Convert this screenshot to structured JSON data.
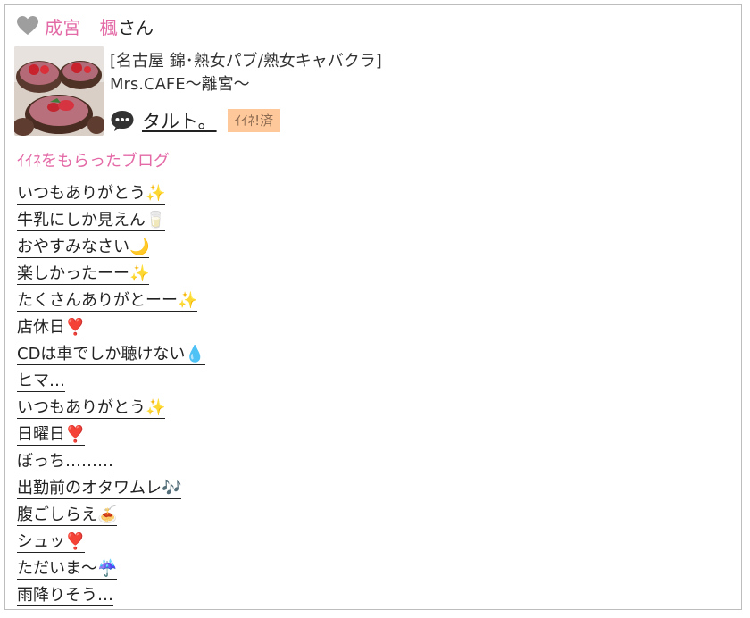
{
  "header": {
    "name": "成宮　楓",
    "honorific": "さん"
  },
  "shop": {
    "category": "[名古屋 錦･熟女パブ/熟女キャバクラ]",
    "name": "Mrs.CAFE〜離宮〜"
  },
  "liker": {
    "name": "タルト。",
    "badge": "ｲｲﾈ!済"
  },
  "section_title": "ｲｲﾈをもらったブログ",
  "blogs": [
    {
      "title": "いつもありがとう✨"
    },
    {
      "title": "牛乳にしか見えん🥛"
    },
    {
      "title": "おやすみなさい🌙"
    },
    {
      "title": "楽しかったーー✨"
    },
    {
      "title": "たくさんありがとーー✨"
    },
    {
      "title": "店休日❣️"
    },
    {
      "title": "CDは車でしか聴けない💧"
    },
    {
      "title": "ヒマ…"
    },
    {
      "title": "いつもありがとう✨"
    },
    {
      "title": "日曜日❣️"
    },
    {
      "title": "ぼっち………"
    },
    {
      "title": "出勤前のオタワムレ🎶"
    },
    {
      "title": "腹ごしらえ🍝"
    },
    {
      "title": "シュッ❣️"
    },
    {
      "title": "ただいま〜☔️"
    },
    {
      "title": "雨降りそう…"
    }
  ],
  "colors": {
    "accent_pink": "#e36aa6",
    "badge_bg": "#ffc89b",
    "heart_icon": "#9e9e9e"
  },
  "icons": {
    "header": "heart-icon",
    "liker": "speech-bubble-icon"
  }
}
